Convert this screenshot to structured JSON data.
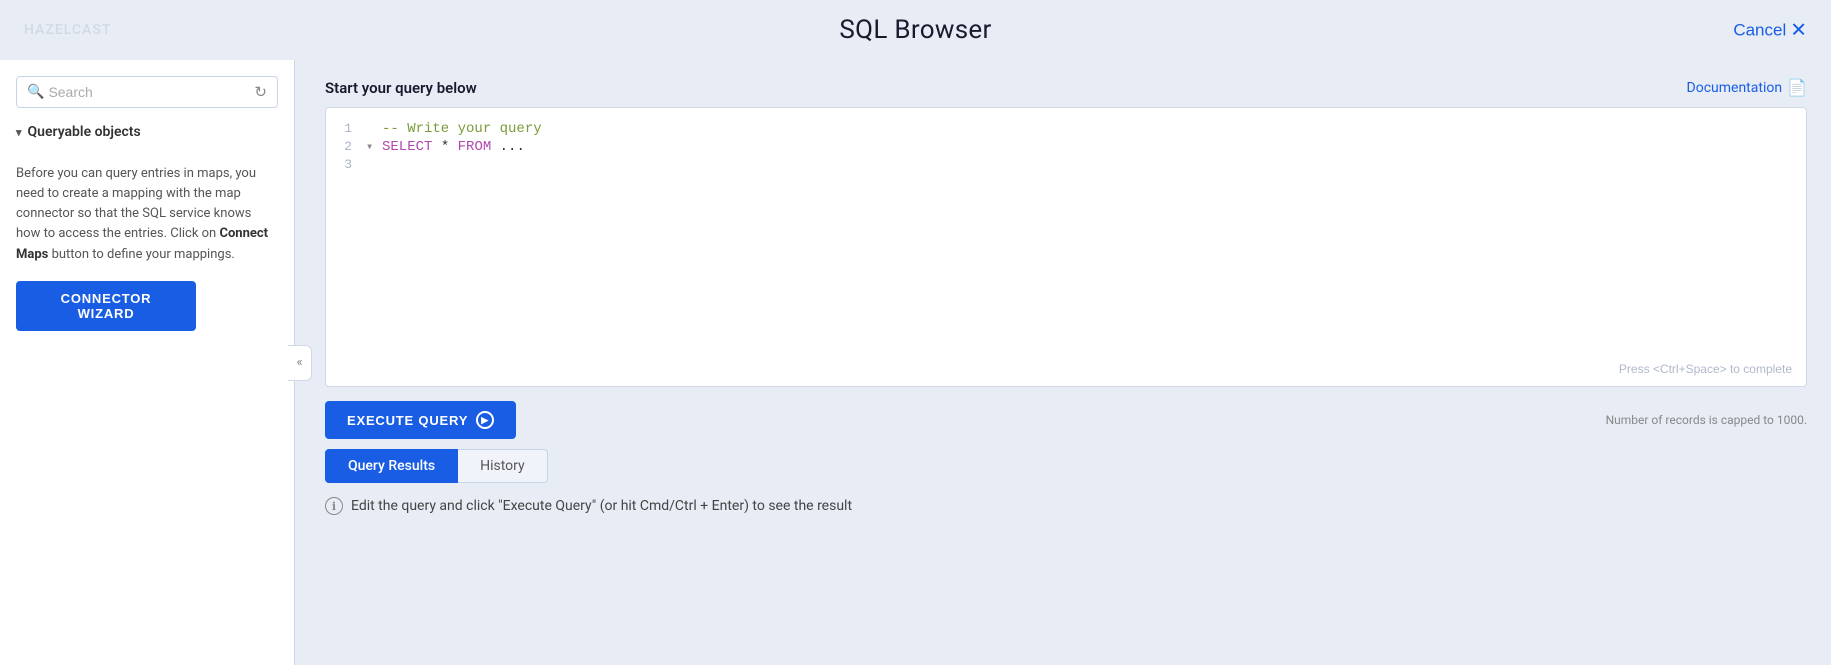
{
  "app": {
    "logo": "HAZELCAST",
    "title": "SQL Browser",
    "cancel_label": "Cancel"
  },
  "sidebar": {
    "search_placeholder": "Search",
    "refresh_icon": "refresh-icon",
    "search_icon": "search-icon",
    "queryable_section": {
      "header": "Queryable objects",
      "chevron": "▾"
    },
    "info_text_parts": [
      "Before you can query entries in maps, you need to create a mapping with the map connector so that the SQL service knows how to access the entries. Click on ",
      "Connect Maps",
      " button to define your mappings."
    ],
    "connector_wizard_label": "CONNECTOR WIZARD"
  },
  "collapse": {
    "icon": "«"
  },
  "content": {
    "query_label": "Start your query below",
    "documentation_label": "Documentation",
    "documentation_icon": "doc-icon"
  },
  "editor": {
    "lines": [
      {
        "number": "1",
        "content": "-- Write your query",
        "type": "comment"
      },
      {
        "number": "2",
        "content": "SELECT * FROM ...",
        "type": "sql"
      },
      {
        "number": "3",
        "content": "",
        "type": "empty"
      }
    ],
    "hint": "Press <Ctrl+Space> to complete"
  },
  "execute_bar": {
    "execute_label": "EXECUTE QUERY",
    "play_icon": "▶",
    "records_cap": "Number of records is capped to 1000."
  },
  "tabs": [
    {
      "id": "query-results",
      "label": "Query Results",
      "active": true
    },
    {
      "id": "history",
      "label": "History",
      "active": false
    }
  ],
  "results": {
    "info_message": "Edit the query and click \"Execute Query\" (or hit Cmd/Ctrl + Enter) to see the result"
  }
}
